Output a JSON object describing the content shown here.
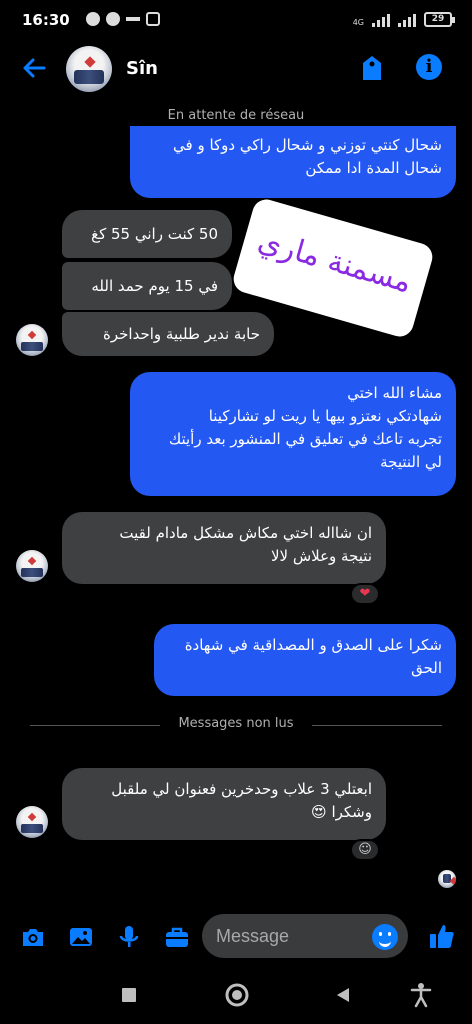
{
  "status_bar": {
    "time": "16:30",
    "network": "4G",
    "battery": "29"
  },
  "header": {
    "contact_name": "Sîn"
  },
  "network_status": "En attente de réseau",
  "messages": [
    {
      "text": "شحال كنتي توزني و شحال راكي دوكا و في\nشحال المدة ادا ممكن"
    },
    {
      "text": "50 كنت راني 55 كغ"
    },
    {
      "text": "في 15 يوم حمد الله"
    },
    {
      "text": "حابة ندير طلبية واحداخرة"
    },
    {
      "text": "مشاء الله اختي\nشهادتكي نعتزو بيها  يا ريت لو تشاركينا\nتجربه تاعك في تعليق في المنشور بعد رأيتك\nلي النتيجة"
    },
    {
      "text": "ان شااله اختي مكاش مشكل مادام لقيت\nنتيجة وعلاش لالا",
      "reaction": "❤"
    },
    {
      "text": "شكرا على الصدق و المصداقية في شهادة\nالحق"
    },
    {
      "text": "ابعتلي 3 علاب وحدخرين فعنوان لي ملقبل\nوشكرا 😍",
      "reaction": "☺"
    }
  ],
  "sticker_text": "مسمنة ماري",
  "unread_divider": "Messages non lus",
  "composer": {
    "placeholder": "Message"
  },
  "colors": {
    "outgoing_bubble": "#2458f2",
    "incoming_bubble": "#3e4042",
    "accent": "#0a7cff",
    "background": "#000000"
  },
  "icons": {
    "header": [
      "back-arrow-icon",
      "tag-icon",
      "info-icon"
    ],
    "composer": [
      "camera-icon",
      "image-icon",
      "microphone-icon",
      "briefcase-icon",
      "emoji-icon",
      "thumbs-up-icon"
    ],
    "nav": [
      "recent-apps-icon",
      "home-icon",
      "back-icon",
      "accessibility-icon"
    ]
  }
}
